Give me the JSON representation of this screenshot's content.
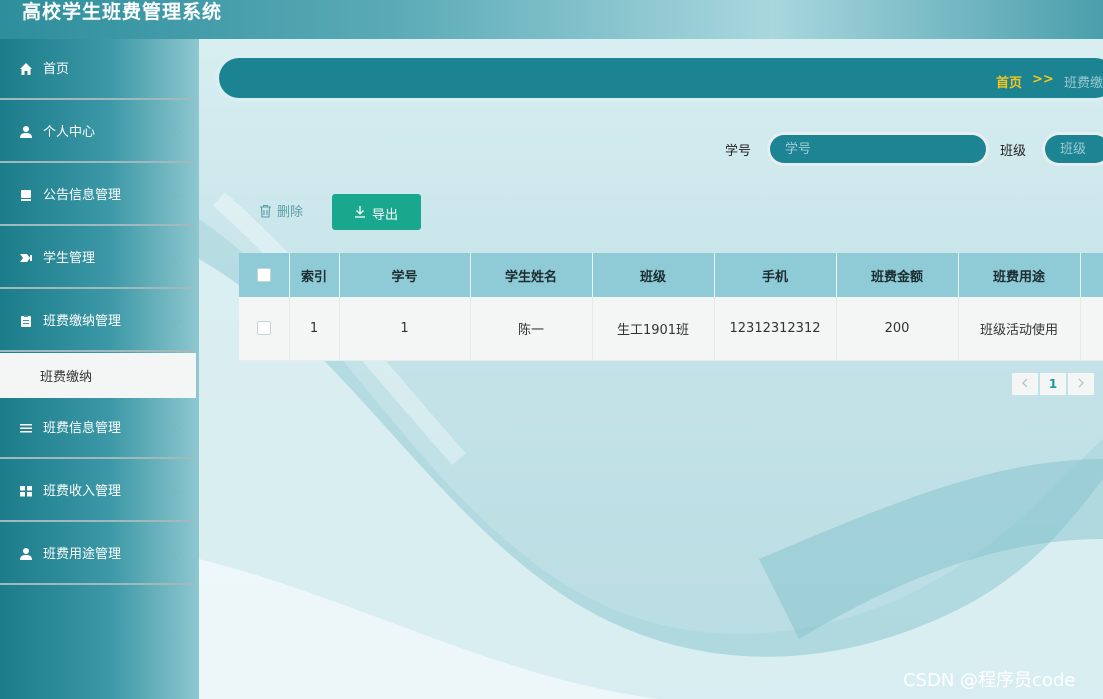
{
  "app": {
    "title": "高校学生班费管理系统"
  },
  "sidebar": {
    "items": [
      {
        "label": "首页",
        "icon": "home-icon"
      },
      {
        "label": "个人中心",
        "icon": "user-icon"
      },
      {
        "label": "公告信息管理",
        "icon": "notice-icon"
      },
      {
        "label": "学生管理",
        "icon": "students-icon"
      },
      {
        "label": "班费缴纳管理",
        "icon": "clipboard-icon"
      },
      {
        "label": "班费信息管理",
        "icon": "list-icon"
      },
      {
        "label": "班费收入管理",
        "icon": "grid-icon"
      },
      {
        "label": "班费用途管理",
        "icon": "user-icon"
      }
    ],
    "active_sub": {
      "label": "班费缴纳"
    }
  },
  "breadcrumb": {
    "home": "首页",
    "separator": ">>",
    "current": "班费缴纳"
  },
  "search": {
    "student_id_label": "学号",
    "student_id_placeholder": "学号",
    "class_label": "班级",
    "class_placeholder": "班级"
  },
  "actions": {
    "delete_label": "删除",
    "export_label": "导出"
  },
  "table": {
    "columns": [
      "索引",
      "学号",
      "学生姓名",
      "班级",
      "手机",
      "班费金额",
      "班费用途"
    ],
    "rows": [
      {
        "index": "1",
        "student_id": "1",
        "name": "陈一",
        "class": "生工1901班",
        "phone": "12312312312",
        "amount": "200",
        "usage": "班级活动使用"
      }
    ]
  },
  "pagination": {
    "current": "1"
  },
  "watermark": "CSDN @程序员code",
  "colors": {
    "accent": "#1c8393",
    "crumb_home": "#f5c51d",
    "export_button": "#19a88e",
    "table_header": "#8ecbd6"
  }
}
